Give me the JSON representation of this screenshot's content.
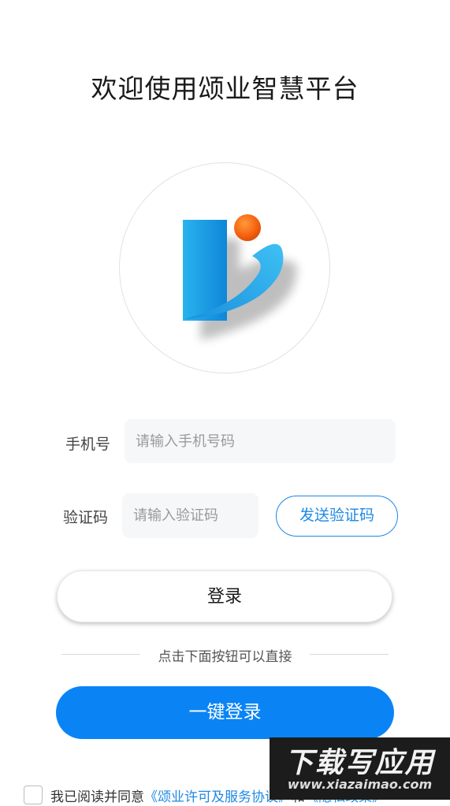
{
  "header": {
    "title": "欢迎使用颂业智慧平台"
  },
  "logo": {
    "icon": "app-logo",
    "brand_color": "#1e9be6",
    "accent_color": "#f25a0f"
  },
  "form": {
    "phone_label": "手机号",
    "phone_placeholder": "请输入手机号码",
    "code_label": "验证码",
    "code_placeholder": "请输入验证码",
    "send_code_label": "发送验证码"
  },
  "actions": {
    "login_label": "登录",
    "divider_text": "点击下面按钮可以直接",
    "one_click_label": "一键登录"
  },
  "agreement": {
    "prefix": "我已阅读并同意",
    "terms_link": "《颂业许可及服务协议》",
    "and": "和",
    "privacy_link": "《隐私政策》"
  },
  "watermark": {
    "line1": "下载写应用",
    "line2": "www.xiazaimao.com"
  },
  "colors": {
    "primary": "#0a84f5",
    "link": "#1e88e5",
    "field_bg": "#f6f7f9"
  }
}
